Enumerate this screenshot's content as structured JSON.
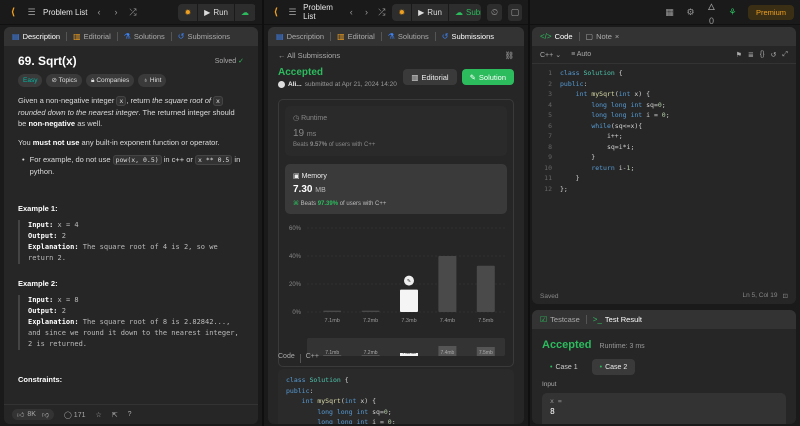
{
  "app": {
    "problem_list": "Problem List",
    "run": "Run",
    "submit": "Submit",
    "premium": "Premium",
    "streak": "0"
  },
  "left": {
    "tabs": [
      "Description",
      "Editorial",
      "Solutions",
      "Submissions"
    ],
    "title": "69. Sqrt(x)",
    "solved": "Solved",
    "chips": [
      "Easy",
      "Topics",
      "Companies",
      "Hint"
    ],
    "p1_a": "Given a non-negative integer ",
    "p1_x": "x",
    "p1_b": ", return ",
    "p1_c": "the square root of ",
    "p1_d": " rounded down to the nearest integer",
    "p1_e": ". The returned integer should be ",
    "p1_f": "non-negative",
    "p1_g": " as well.",
    "p2_a": "You ",
    "p2_b": "must not use",
    "p2_c": " any built-in exponent function or operator.",
    "bullet_a": "For example, do not use ",
    "bullet_code1": "pow(x, 0.5)",
    "bullet_b": " in c++ or ",
    "bullet_code2": "x ** 0.5",
    "bullet_c": " in python.",
    "ex1_title": "Example 1:",
    "ex1_input": "x = 4",
    "ex1_output": "2",
    "ex1_expl": "The square root of 4 is 2, so we return 2.",
    "ex2_title": "Example 2:",
    "ex2_input": "x = 8",
    "ex2_output": "2",
    "ex2_expl": "The square root of 8 is 2.82842..., and since we round it down to the nearest integer, 2 is returned.",
    "input_label": "Input:",
    "output_label": "Output:",
    "expl_label": "Explanation:",
    "constraints": "Constraints:",
    "likes": "8K",
    "comments": "171"
  },
  "mid": {
    "tabs": [
      "Description",
      "Editorial",
      "Solutions",
      "Submissions"
    ],
    "back": "All Submissions",
    "status": "Accepted",
    "user": "Ali...",
    "submitted": "submitted at Apr 21, 2024 14:20",
    "editorial_btn": "Editorial",
    "solution_btn": "Solution",
    "runtime_label": "Runtime",
    "runtime_value": "19",
    "runtime_unit": "ms",
    "runtime_beats_a": "Beats ",
    "runtime_beats": "9.57%",
    "runtime_beats_b": " of users with C++",
    "memory_label": "Memory",
    "memory_value": "7.30",
    "memory_unit": "MB",
    "memory_beats_a": "Beats ",
    "memory_beats": "97.39%",
    "memory_beats_b": " of users with C++",
    "code_label": "Code",
    "lang": "C++"
  },
  "chart_data": {
    "type": "bar",
    "categories": [
      "7.1mb",
      "7.2mb",
      "7.3mb",
      "7.4mb",
      "7.5mb"
    ],
    "values": [
      1,
      1,
      16,
      40,
      33
    ],
    "highlight": "7.3mb",
    "yticks": [
      "60%",
      "40%",
      "20%",
      "0%"
    ],
    "ylim": [
      0,
      60
    ],
    "mini_values": [
      1,
      1,
      3,
      10,
      9
    ]
  },
  "right": {
    "code_tab": "Code",
    "note_tab": "Note",
    "lang": "C++",
    "auto": "Auto",
    "saved": "Saved",
    "cursor": "Ln 5, Col 19",
    "testcase_tab": "Testcase",
    "result_tab": "Test Result",
    "status": "Accepted",
    "runtime": "Runtime: 3 ms",
    "cases": [
      "Case 1",
      "Case 2"
    ],
    "input_label": "Input",
    "var": "x =",
    "val": "8"
  },
  "code_lines": [
    "class Solution {",
    "public:",
    "    int mySqrt(int x) {",
    "        long long int sq=0;",
    "        long long int i = 0;",
    "        while(sq<=x){",
    "            i++;",
    "            sq=i*i;",
    "        }",
    "        return i-1;",
    "    }",
    "};"
  ]
}
